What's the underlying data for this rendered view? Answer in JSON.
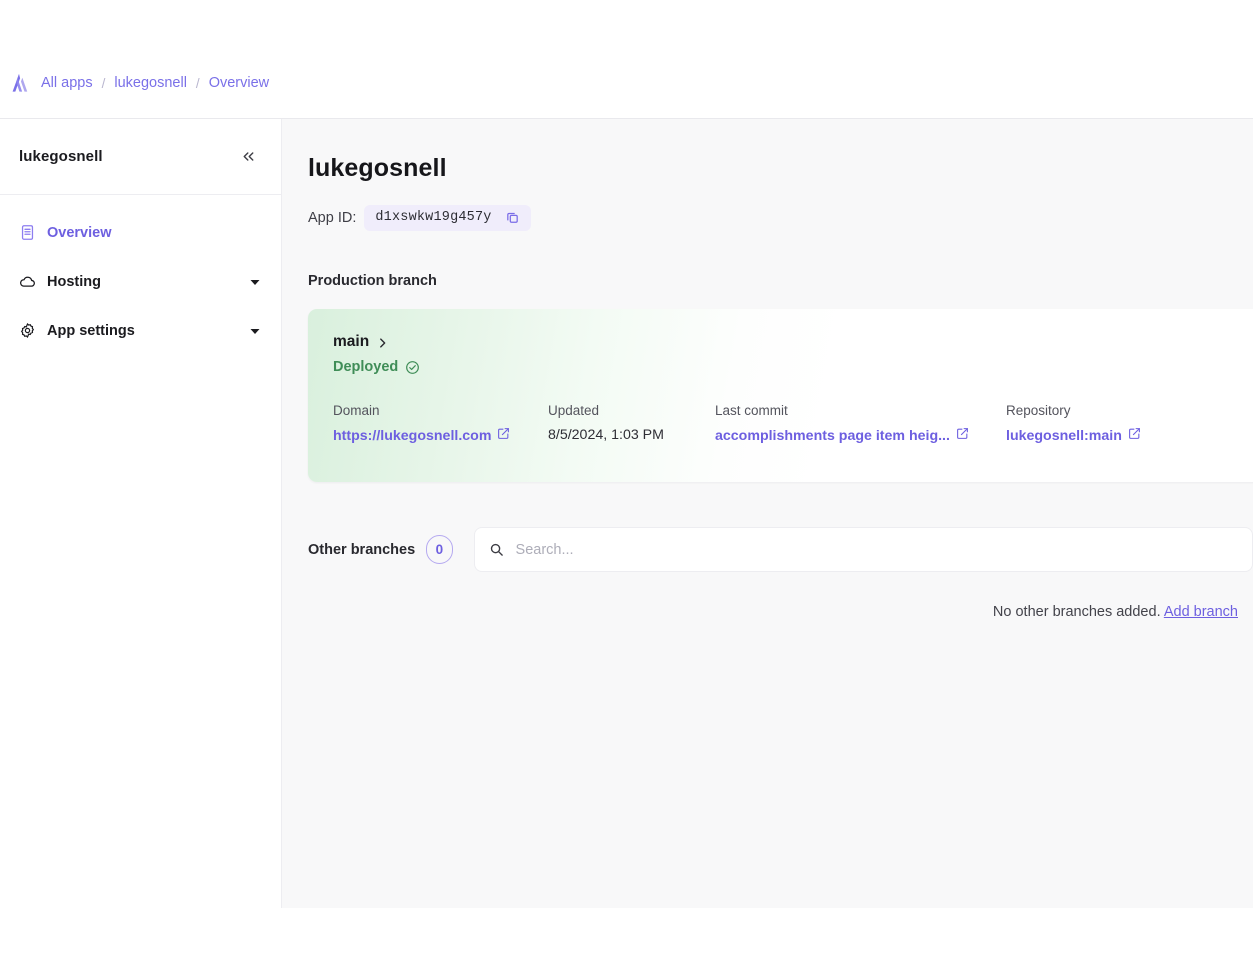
{
  "breadcrumb": {
    "logo_icon": "amplify-logo-icon",
    "items": [
      {
        "label": "All apps"
      },
      {
        "label": "lukegosnell"
      },
      {
        "label": "Overview"
      }
    ],
    "separator": "/"
  },
  "sidebar": {
    "title": "lukegosnell",
    "collapse_icon": "chevron-double-left-icon",
    "items": [
      {
        "label": "Overview",
        "icon": "document-list-icon",
        "active": true,
        "has_caret": false
      },
      {
        "label": "Hosting",
        "icon": "cloud-icon",
        "active": false,
        "has_caret": true
      },
      {
        "label": "App settings",
        "icon": "gear-icon",
        "active": false,
        "has_caret": true
      }
    ]
  },
  "main": {
    "app_title": "lukegosnell",
    "app_id_label": "App ID:",
    "app_id_value": "d1xswkw19g457y",
    "copy_icon": "copy-icon",
    "production_branch_label": "Production branch",
    "branch_card": {
      "name": "main",
      "chevron_icon": "chevron-right-icon",
      "status": "Deployed",
      "status_icon": "check-circle-icon",
      "status_color": "#3f8d57",
      "fields": [
        {
          "header": "Domain",
          "value": "https://lukegosnell.com",
          "link": true,
          "external_icon": "external-link-icon"
        },
        {
          "header": "Updated",
          "value": "8/5/2024, 1:03 PM",
          "link": false,
          "external_icon": ""
        },
        {
          "header": "Last commit",
          "value": "accomplishments page item heig...",
          "link": true,
          "external_icon": "external-link-icon"
        },
        {
          "header": "Repository",
          "value": "lukegosnell:main",
          "link": true,
          "external_icon": "external-link-icon"
        }
      ]
    },
    "other_branches": {
      "label": "Other branches",
      "count": "0",
      "search_icon": "search-icon",
      "search_placeholder": "Search...",
      "search_value": "",
      "empty_text": "No other branches added.",
      "add_branch_label": "Add branch"
    }
  },
  "colors": {
    "accent": "#6d5fe0",
    "breadcrumb_link": "#7a70e8",
    "success": "#3f8d57",
    "panel_bg": "#f8f8f9",
    "chip_bg": "#f0edfb"
  }
}
